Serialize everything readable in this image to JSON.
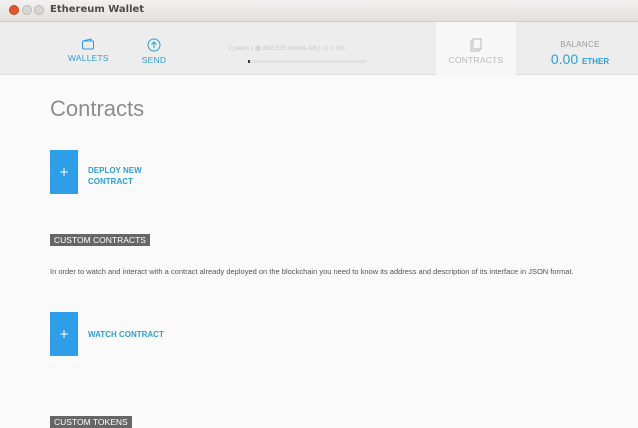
{
  "window": {
    "title": "Ethereum Wallet"
  },
  "header": {
    "nav": {
      "wallets": "WALLETS",
      "send": "SEND",
      "contracts": "CONTRACTS"
    },
    "sync": {
      "peers": "2 peers",
      "blocks": "882,555 blocks left",
      "percent": "0.1%",
      "progress": 0.01
    },
    "balance": {
      "label": "BALANCE",
      "value": "0.00",
      "unit": "ETHER"
    }
  },
  "main": {
    "title": "Contracts",
    "deploy": {
      "button_symbol": "+",
      "label_line1": "DEPLOY NEW",
      "label_line2": "CONTRACT"
    },
    "custom_contracts": {
      "header": "CUSTOM CONTRACTS",
      "description": "In order to watch and interact with a contract already deployed on the blockchain you need to know its address and description of its interface in JSON format.",
      "watch_button_symbol": "+",
      "watch_label": "WATCH CONTRACT"
    },
    "custom_tokens": {
      "header": "CUSTOM TOKENS"
    }
  },
  "colors": {
    "accent": "#2e9fd3",
    "button": "#2f9ee8",
    "section_header": "#666666"
  }
}
